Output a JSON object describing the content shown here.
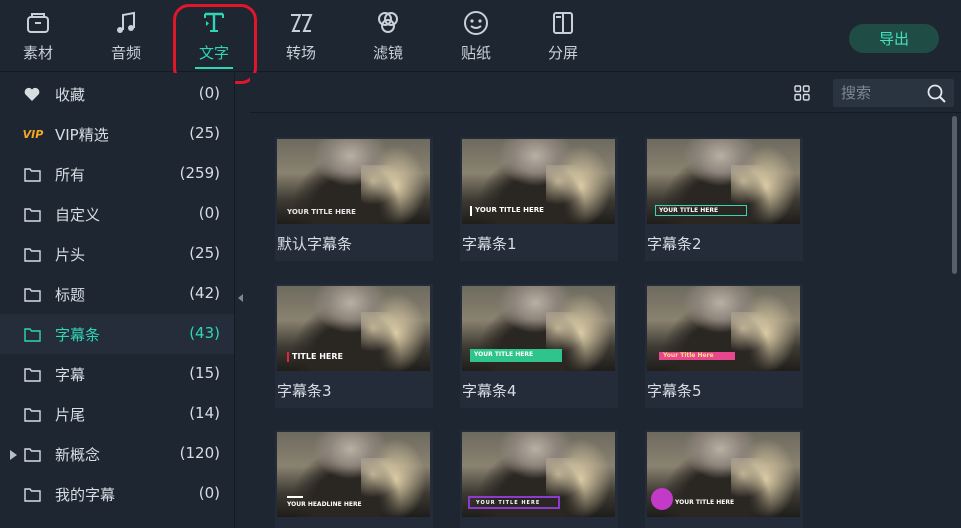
{
  "toolbar": {
    "tabs": [
      {
        "label": "素材",
        "icon": "folder-media-icon"
      },
      {
        "label": "音频",
        "icon": "music-note-icon"
      },
      {
        "label": "文字",
        "icon": "text-title-icon",
        "active": true
      },
      {
        "label": "转场",
        "icon": "transition-icon"
      },
      {
        "label": "滤镜",
        "icon": "filter-icon"
      },
      {
        "label": "贴纸",
        "icon": "sticker-icon"
      },
      {
        "label": "分屏",
        "icon": "split-screen-icon"
      }
    ],
    "export_label": "导出"
  },
  "sidebar": {
    "items": [
      {
        "label": "收藏",
        "count": "(0)",
        "icon": "heart-icon"
      },
      {
        "label": "VIP精选",
        "count": "(25)",
        "icon": "vip-badge-icon",
        "badge_text": "VIP"
      },
      {
        "label": "所有",
        "count": "(259)",
        "icon": "folder-icon"
      },
      {
        "label": "自定义",
        "count": "(0)",
        "icon": "folder-icon"
      },
      {
        "label": "片头",
        "count": "(25)",
        "icon": "folder-icon"
      },
      {
        "label": "标题",
        "count": "(42)",
        "icon": "folder-icon"
      },
      {
        "label": "字幕条",
        "count": "(43)",
        "icon": "folder-icon",
        "active": true
      },
      {
        "label": "字幕",
        "count": "(15)",
        "icon": "folder-icon"
      },
      {
        "label": "片尾",
        "count": "(14)",
        "icon": "folder-icon"
      },
      {
        "label": "新概念",
        "count": "(120)",
        "icon": "folder-icon",
        "expandable": true
      },
      {
        "label": "我的字幕",
        "count": "(0)",
        "icon": "folder-icon"
      }
    ]
  },
  "search": {
    "placeholder": "搜索"
  },
  "grid": {
    "cards": [
      {
        "label": "默认字幕条",
        "overlay_text": "YOUR TITLE HERE"
      },
      {
        "label": "字幕条1",
        "overlay_text": "YOUR TITLE HERE"
      },
      {
        "label": "字幕条2",
        "overlay_text": "YOUR TITLE HERE"
      },
      {
        "label": "字幕条3",
        "overlay_text": "TITLE HERE"
      },
      {
        "label": "字幕条4",
        "overlay_text": "YOUR TITLE HERE"
      },
      {
        "label": "字幕条5",
        "overlay_text": "Your Title Here"
      },
      {
        "label": "",
        "overlay_text": "YOUR HEADLINE HERE"
      },
      {
        "label": "",
        "overlay_text": "YOUR TITLE HERE"
      },
      {
        "label": "",
        "overlay_text": "YOUR TITLE HERE"
      }
    ]
  },
  "colors": {
    "accent": "#2fd6b5",
    "background": "#1e2631",
    "annotation_ring": "#e0162b",
    "export_button_bg": "#1f4d45"
  }
}
